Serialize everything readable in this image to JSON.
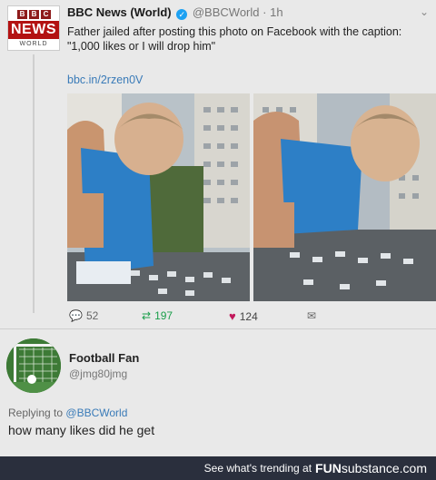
{
  "tweet": {
    "account_name": "BBC News (World)",
    "handle": "@BBCWorld",
    "time": "1h",
    "separator": "·",
    "text_line1": "Father jailed after posting this photo on Facebook with the caption:",
    "text_line2": "\"1,000 likes or I will drop him\"",
    "link": "bbc.in/2rzen0V",
    "avatar_logo_blocks": [
      "B",
      "B",
      "C"
    ],
    "avatar_logo_main": "NEWS",
    "avatar_logo_sub": "WORLD",
    "replies": "52",
    "retweets": "197",
    "likes": "124"
  },
  "reply": {
    "name": "Football Fan",
    "handle": "@jmg80jmg",
    "replying_to_prefix": "Replying to",
    "replying_to_handle": "@BBCWorld",
    "text": "how many likes did he get"
  },
  "footer": {
    "prefix": "See what's trending at",
    "brand_bold": "FUN",
    "brand_rest": "substance",
    "brand_tld": ".com"
  },
  "colors": {
    "bbc_red": "#b31212",
    "link_blue": "#3a7bb8",
    "retweet_green": "#1a9e4a",
    "like_pink": "#c2185b",
    "footer_bg": "#2a2f3d"
  }
}
